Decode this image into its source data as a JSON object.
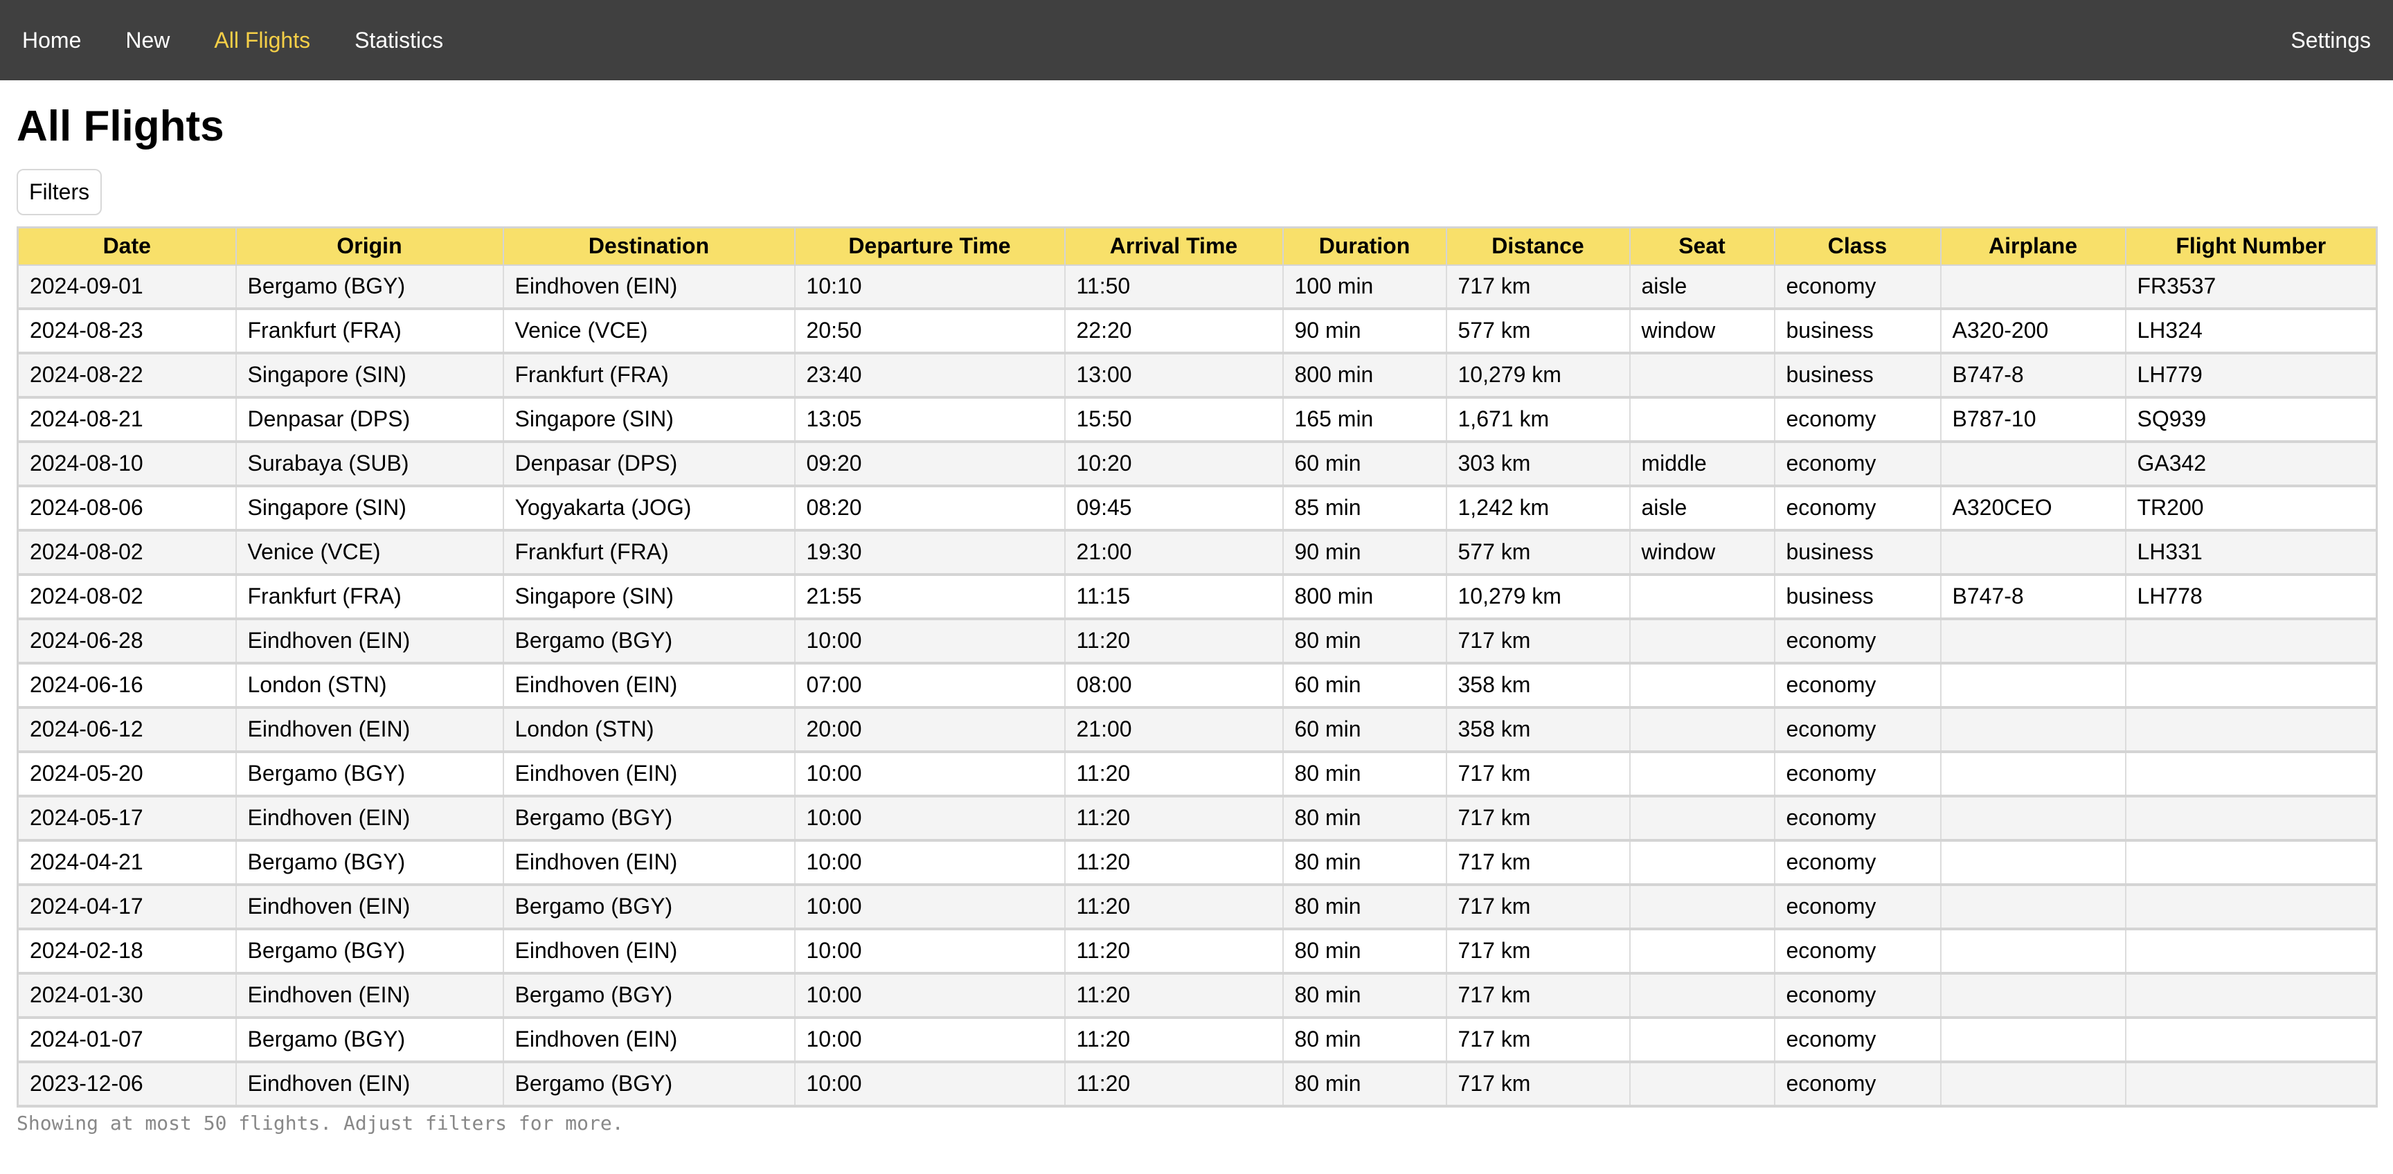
{
  "nav": {
    "items": [
      {
        "label": "Home",
        "active": false
      },
      {
        "label": "New",
        "active": false
      },
      {
        "label": "All Flights",
        "active": true
      },
      {
        "label": "Statistics",
        "active": false
      }
    ],
    "settings_label": "Settings"
  },
  "page": {
    "title": "All Flights",
    "filters_label": "Filters",
    "footer_note": "Showing at most 50 flights. Adjust filters for more."
  },
  "colors": {
    "navbar_bg": "#404040",
    "nav_active": "#f5cf47",
    "table_header_bg": "#f8e06a"
  },
  "table": {
    "columns": [
      "Date",
      "Origin",
      "Destination",
      "Departure Time",
      "Arrival Time",
      "Duration",
      "Distance",
      "Seat",
      "Class",
      "Airplane",
      "Flight Number"
    ],
    "rows": [
      [
        "2024-09-01",
        "Bergamo (BGY)",
        "Eindhoven (EIN)",
        "10:10",
        "11:50",
        "100 min",
        "717 km",
        "aisle",
        "economy",
        "",
        "FR3537"
      ],
      [
        "2024-08-23",
        "Frankfurt (FRA)",
        "Venice (VCE)",
        "20:50",
        "22:20",
        "90 min",
        "577 km",
        "window",
        "business",
        "A320-200",
        "LH324"
      ],
      [
        "2024-08-22",
        "Singapore (SIN)",
        "Frankfurt (FRA)",
        "23:40",
        "13:00",
        "800 min",
        "10,279 km",
        "",
        "business",
        "B747-8",
        "LH779"
      ],
      [
        "2024-08-21",
        "Denpasar (DPS)",
        "Singapore (SIN)",
        "13:05",
        "15:50",
        "165 min",
        "1,671 km",
        "",
        "economy",
        "B787-10",
        "SQ939"
      ],
      [
        "2024-08-10",
        "Surabaya (SUB)",
        "Denpasar (DPS)",
        "09:20",
        "10:20",
        "60 min",
        "303 km",
        "middle",
        "economy",
        "",
        "GA342"
      ],
      [
        "2024-08-06",
        "Singapore (SIN)",
        "Yogyakarta (JOG)",
        "08:20",
        "09:45",
        "85 min",
        "1,242 km",
        "aisle",
        "economy",
        "A320CEO",
        "TR200"
      ],
      [
        "2024-08-02",
        "Venice (VCE)",
        "Frankfurt (FRA)",
        "19:30",
        "21:00",
        "90 min",
        "577 km",
        "window",
        "business",
        "",
        "LH331"
      ],
      [
        "2024-08-02",
        "Frankfurt (FRA)",
        "Singapore (SIN)",
        "21:55",
        "11:15",
        "800 min",
        "10,279 km",
        "",
        "business",
        "B747-8",
        "LH778"
      ],
      [
        "2024-06-28",
        "Eindhoven (EIN)",
        "Bergamo (BGY)",
        "10:00",
        "11:20",
        "80 min",
        "717 km",
        "",
        "economy",
        "",
        ""
      ],
      [
        "2024-06-16",
        "London (STN)",
        "Eindhoven (EIN)",
        "07:00",
        "08:00",
        "60 min",
        "358 km",
        "",
        "economy",
        "",
        ""
      ],
      [
        "2024-06-12",
        "Eindhoven (EIN)",
        "London (STN)",
        "20:00",
        "21:00",
        "60 min",
        "358 km",
        "",
        "economy",
        "",
        ""
      ],
      [
        "2024-05-20",
        "Bergamo (BGY)",
        "Eindhoven (EIN)",
        "10:00",
        "11:20",
        "80 min",
        "717 km",
        "",
        "economy",
        "",
        ""
      ],
      [
        "2024-05-17",
        "Eindhoven (EIN)",
        "Bergamo (BGY)",
        "10:00",
        "11:20",
        "80 min",
        "717 km",
        "",
        "economy",
        "",
        ""
      ],
      [
        "2024-04-21",
        "Bergamo (BGY)",
        "Eindhoven (EIN)",
        "10:00",
        "11:20",
        "80 min",
        "717 km",
        "",
        "economy",
        "",
        ""
      ],
      [
        "2024-04-17",
        "Eindhoven (EIN)",
        "Bergamo (BGY)",
        "10:00",
        "11:20",
        "80 min",
        "717 km",
        "",
        "economy",
        "",
        ""
      ],
      [
        "2024-02-18",
        "Bergamo (BGY)",
        "Eindhoven (EIN)",
        "10:00",
        "11:20",
        "80 min",
        "717 km",
        "",
        "economy",
        "",
        ""
      ],
      [
        "2024-01-30",
        "Eindhoven (EIN)",
        "Bergamo (BGY)",
        "10:00",
        "11:20",
        "80 min",
        "717 km",
        "",
        "economy",
        "",
        ""
      ],
      [
        "2024-01-07",
        "Bergamo (BGY)",
        "Eindhoven (EIN)",
        "10:00",
        "11:20",
        "80 min",
        "717 km",
        "",
        "economy",
        "",
        ""
      ],
      [
        "2023-12-06",
        "Eindhoven (EIN)",
        "Bergamo (BGY)",
        "10:00",
        "11:20",
        "80 min",
        "717 km",
        "",
        "economy",
        "",
        ""
      ]
    ]
  }
}
